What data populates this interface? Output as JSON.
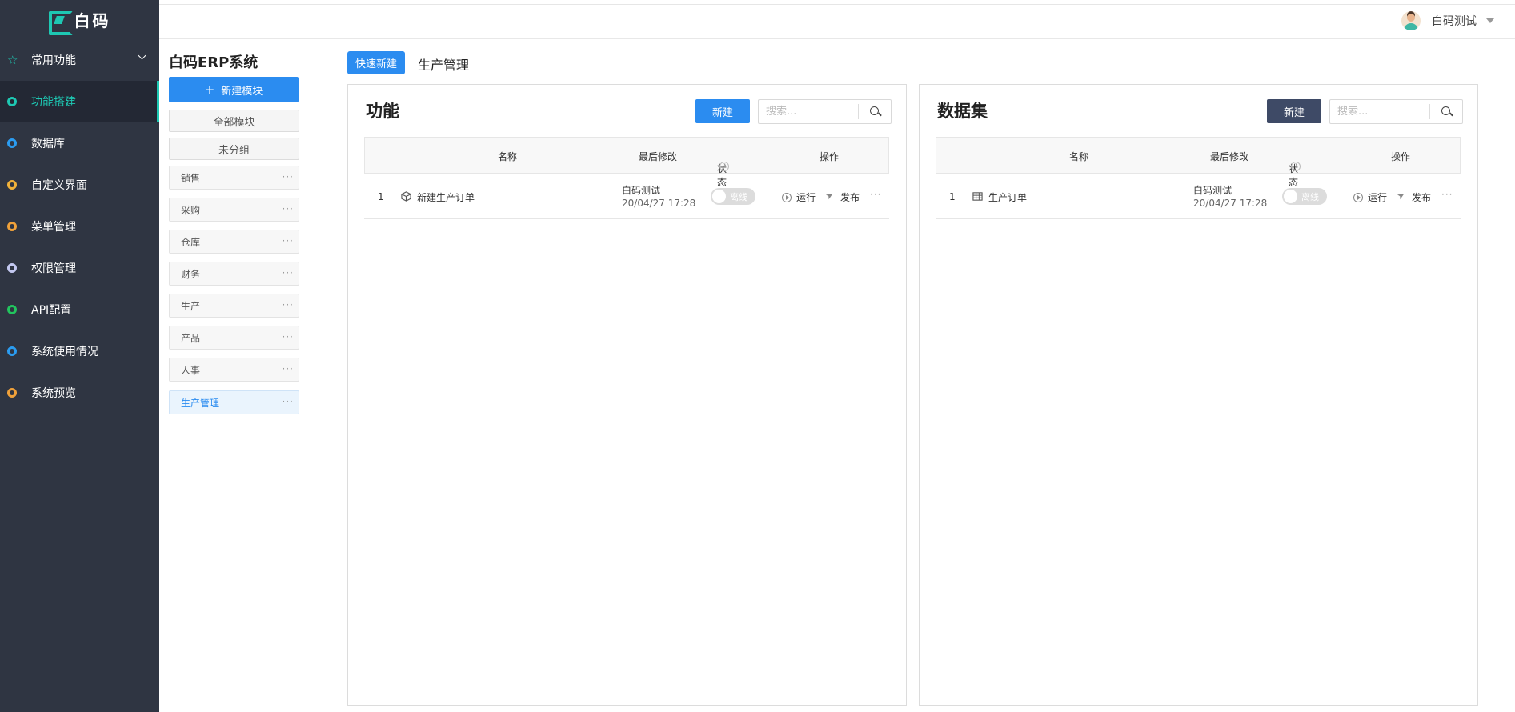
{
  "app": {
    "logo_text": "白码"
  },
  "header": {
    "user_name": "白码测试"
  },
  "sidebar": {
    "items": [
      {
        "label": "常用功能",
        "color": "#1ec8b3"
      },
      {
        "label": "功能搭建",
        "color": "#1ec8b3"
      },
      {
        "label": "数据库",
        "color": "#2b9cf0"
      },
      {
        "label": "自定义界面",
        "color": "#f0b13a"
      },
      {
        "label": "菜单管理",
        "color": "#f0a13a"
      },
      {
        "label": "权限管理",
        "color": "#c3c8f0"
      },
      {
        "label": "API配置",
        "color": "#22c55e"
      },
      {
        "label": "系统使用情况",
        "color": "#2b9cf0"
      },
      {
        "label": "系统预览",
        "color": "#f0a13a"
      }
    ]
  },
  "modules": {
    "system_title": "白码ERP系统",
    "new_module_label": "新建模块",
    "all_modules_label": "全部模块",
    "ungrouped_label": "未分组",
    "items": [
      "销售",
      "采购",
      "仓库",
      "财务",
      "生产",
      "产品",
      "人事",
      "生产管理"
    ],
    "more_glyph": "···"
  },
  "main": {
    "quick_new_label": "快速新建",
    "breadcrumb": "生产管理",
    "functions": {
      "title": "功能",
      "new_label": "新建",
      "new_color": "#2b8cf0",
      "search_placeholder": "搜索...",
      "columns": {
        "name": "名称",
        "last_modified": "最后修改",
        "status": "状态",
        "actions": "操作"
      },
      "rows": [
        {
          "index": "1",
          "name": "新建生产订单",
          "modified_by": "白码测试",
          "modified_at": "20/04/27 17:28",
          "status": "离线",
          "run": "运行",
          "publish": "发布",
          "more": "···"
        }
      ]
    },
    "datasets": {
      "title": "数据集",
      "new_label": "新建",
      "new_color": "#3e4a66",
      "search_placeholder": "搜索...",
      "columns": {
        "name": "名称",
        "last_modified": "最后修改",
        "status": "状态",
        "actions": "操作"
      },
      "rows": [
        {
          "index": "1",
          "name": "生产订单",
          "modified_by": "白码测试",
          "modified_at": "20/04/27 17:28",
          "status": "离线",
          "run": "运行",
          "publish": "发布",
          "more": "···"
        }
      ]
    }
  }
}
